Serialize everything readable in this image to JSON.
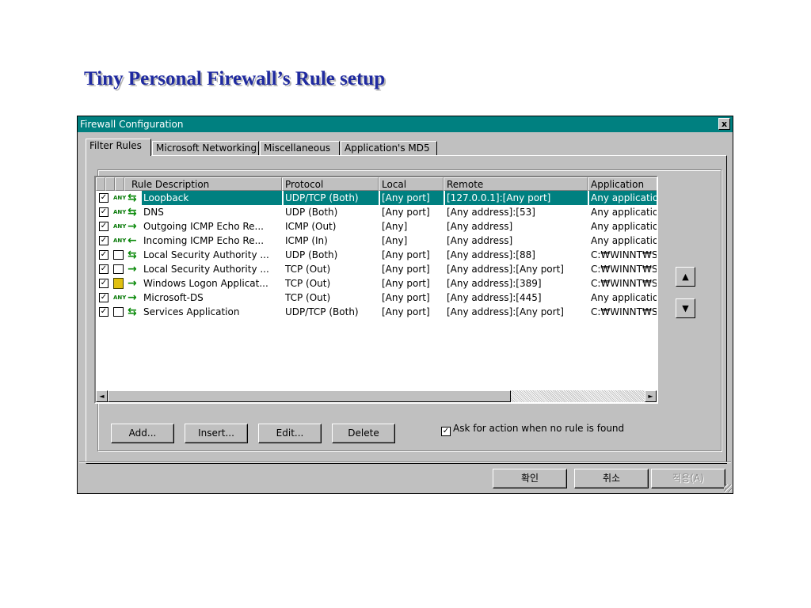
{
  "slide_title": "Tiny Personal Firewall’s Rule setup",
  "window": {
    "title": "Firewall Configuration",
    "close_label": "x"
  },
  "tabs": [
    {
      "label": "Filter Rules"
    },
    {
      "label": "Microsoft Networking"
    },
    {
      "label": "Miscellaneous"
    },
    {
      "label": "Application's MD5"
    }
  ],
  "columns": [
    "Rule Description",
    "Protocol",
    "Local",
    "Remote",
    "Application"
  ],
  "rules": [
    {
      "checked": true,
      "icon": "any",
      "dir": "both",
      "description": "Loopback",
      "protocol": "UDP/TCP (Both)",
      "local": "[Any port]",
      "remote": "[127.0.0.1]:[Any port]",
      "application": "Any applicatio",
      "selected": true
    },
    {
      "checked": true,
      "icon": "any",
      "dir": "both",
      "description": "DNS",
      "protocol": "UDP (Both)",
      "local": "[Any port]",
      "remote": "[Any address]:[53]",
      "application": "Any applicatio"
    },
    {
      "checked": true,
      "icon": "any",
      "dir": "out",
      "description": "Outgoing ICMP Echo Re...",
      "protocol": "ICMP (Out)",
      "local": "[Any]",
      "remote": "[Any address]",
      "application": "Any applicatio"
    },
    {
      "checked": true,
      "icon": "any",
      "dir": "in",
      "description": "Incoming ICMP Echo Re...",
      "protocol": "ICMP (In)",
      "local": "[Any]",
      "remote": "[Any address]",
      "application": "Any applicatio"
    },
    {
      "checked": true,
      "icon": "box",
      "dir": "both",
      "description": "Local Security Authority ...",
      "protocol": "UDP (Both)",
      "local": "[Any port]",
      "remote": "[Any address]:[88]",
      "application": "C:₩WINNT₩S"
    },
    {
      "checked": true,
      "icon": "box",
      "dir": "out",
      "description": "Local Security Authority ...",
      "protocol": "TCP (Out)",
      "local": "[Any port]",
      "remote": "[Any address]:[Any port]",
      "application": "C:₩WINNT₩S"
    },
    {
      "checked": true,
      "icon": "user",
      "dir": "out",
      "description": "Windows Logon Applicat...",
      "protocol": "TCP (Out)",
      "local": "[Any port]",
      "remote": "[Any address]:[389]",
      "application": "C:₩WINNT₩S"
    },
    {
      "checked": true,
      "icon": "any",
      "dir": "out",
      "description": "Microsoft-DS",
      "protocol": "TCP (Out)",
      "local": "[Any port]",
      "remote": "[Any address]:[445]",
      "application": "Any applicatio"
    },
    {
      "checked": true,
      "icon": "box",
      "dir": "both",
      "description": "Services Application",
      "protocol": "UDP/TCP (Both)",
      "local": "[Any port]",
      "remote": "[Any address]:[Any port]",
      "application": "C:₩WINNT₩S"
    }
  ],
  "any_badge": "ANY",
  "side_buttons": {
    "up": "▲",
    "down": "▼"
  },
  "scroll": {
    "left": "◄",
    "right": "►"
  },
  "buttons": {
    "add": "Add...",
    "insert": "Insert...",
    "edit": "Edit...",
    "delete": "Delete"
  },
  "ask_option": {
    "checked": true,
    "label": "Ask for action when no rule is found"
  },
  "footer_buttons": {
    "ok": "확인",
    "cancel": "취소",
    "apply": "적용(A)"
  },
  "colors": {
    "titlebar": "#008080",
    "selection": "#008080",
    "title_text": "#1f2aa0",
    "face": "#c0c0c0"
  }
}
